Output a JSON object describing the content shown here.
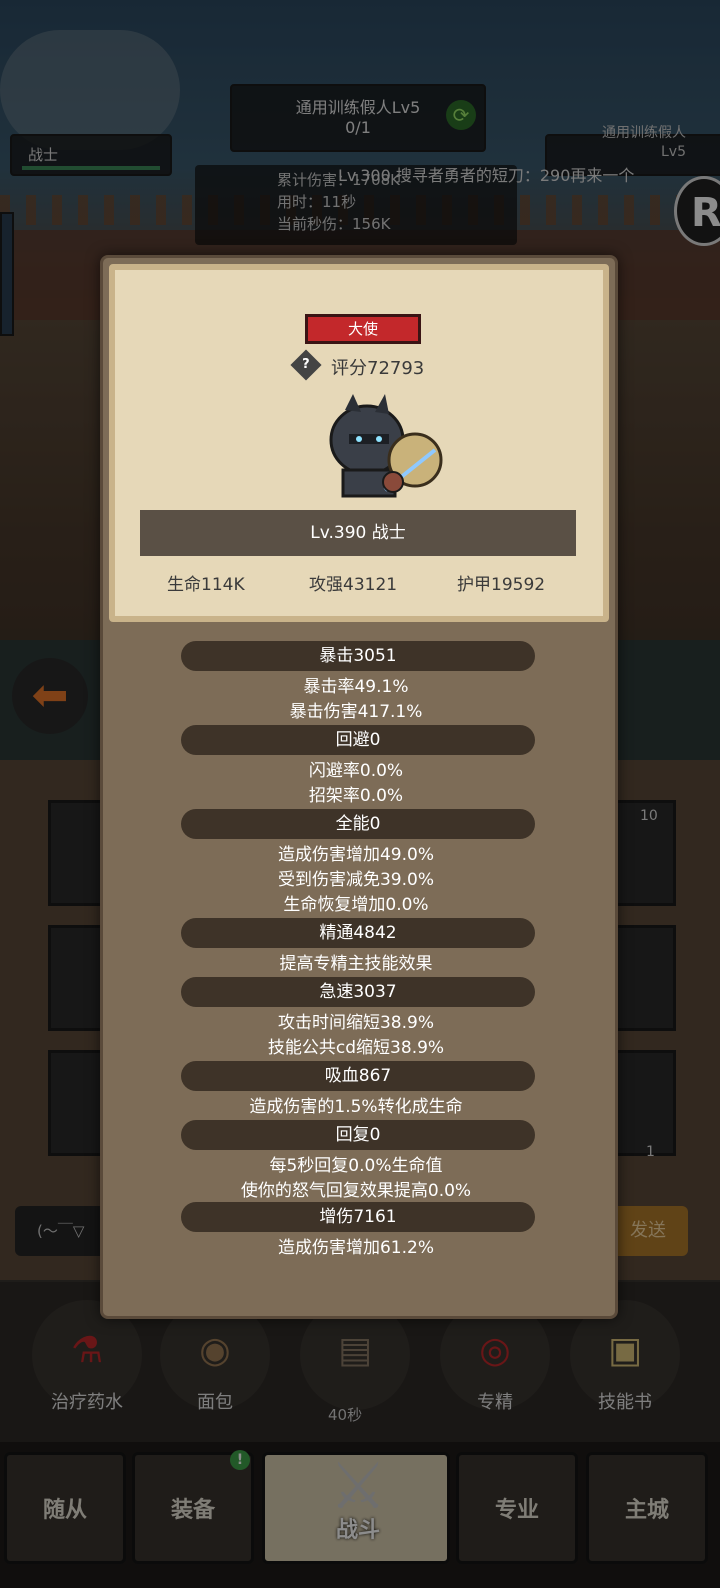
{
  "background": {
    "boss": {
      "name": "通用训练假人Lv5",
      "progress": "0/1"
    },
    "player_bar": {
      "name": "战士"
    },
    "enemy_bar": {
      "name": "通用训练假人",
      "level": "Lv5"
    },
    "battle_stats": [
      "累计伤害：1708K",
      "用时：11秒",
      "当前秒伤：156K"
    ],
    "chat_scroll": "Lv.300 搜寻者勇者的短刀：290再来一个",
    "r_icon": "R",
    "slot_counts": [
      "10",
      "1"
    ],
    "chat_input_text": "(～￣▽",
    "send_label": "发送",
    "consumables": [
      {
        "label": "治疗药水",
        "icon": "potion-icon"
      },
      {
        "label": "面包",
        "icon": "bread-icon"
      },
      {
        "label": "",
        "icon": "chest-icon",
        "timer": "40秒"
      },
      {
        "label": "专精",
        "icon": "spec-icon"
      },
      {
        "label": "技能书",
        "icon": "book-icon"
      }
    ],
    "nav": [
      "随从",
      "装备",
      "战斗",
      "专业",
      "主城"
    ],
    "nav_badge": "!"
  },
  "popup": {
    "rank_badge": "大使",
    "score": "评分72793",
    "level_name": "Lv.390 战士",
    "base_stats": {
      "hp": "生命114K",
      "atk": "攻强43121",
      "armor": "护甲19592"
    },
    "attributes": [
      {
        "header": "暴击3051",
        "lines": [
          "暴击率49.1%",
          "暴击伤害417.1%"
        ]
      },
      {
        "header": "回避0",
        "lines": [
          "闪避率0.0%",
          "招架率0.0%"
        ]
      },
      {
        "header": "全能0",
        "lines": [
          "造成伤害增加49.0%",
          "受到伤害减免39.0%",
          "生命恢复增加0.0%"
        ]
      },
      {
        "header": "精通4842",
        "lines": [
          "提高专精主技能效果"
        ]
      },
      {
        "header": "急速3037",
        "lines": [
          "攻击时间缩短38.9%",
          "技能公共cd缩短38.9%"
        ]
      },
      {
        "header": "吸血867",
        "lines": [
          "造成伤害的1.5%转化成生命"
        ]
      },
      {
        "header": "回复0",
        "lines": [
          "每5秒回复0.0%生命值",
          "使你的怒气回复效果提高0.0%"
        ]
      },
      {
        "header": "增伤7161",
        "lines": [
          "造成伤害增加61.2%"
        ]
      }
    ]
  }
}
